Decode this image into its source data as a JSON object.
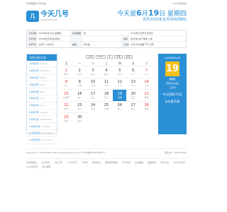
{
  "top": {
    "left": "农历网首页 天天在线",
    "right": "2023年农历表"
  },
  "logo": {
    "mark": "几",
    "title": "今天几号",
    "url": "jintianjihao.com"
  },
  "today": {
    "pre": "今天是",
    "month": "6",
    "mid": "月",
    "day": "19",
    "post": "日 星期四",
    "sub": "农历2025年五月廿四(周四)"
  },
  "info": [
    [
      "今天日期",
      "2025年6月19日 星期四",
      "生肖属相",
      "蛇",
      "",
      "2025年乙巳年五月廿四"
    ],
    [
      "今天农历",
      "2025年五月廿四(周四)",
      "",
      "",
      "宜忌",
      "宜:沐浴 出行 移徙 入宅"
    ],
    [
      "今天节日",
      "父亲节 公共节日",
      "星座",
      "双子座",
      "今天相关",
      "今天几号 星期 节气 农历"
    ]
  ],
  "sidebar": {
    "title": "月份日历大全",
    "items": [
      {
        "label": "1月份日历",
        "en": "January"
      },
      {
        "label": "2月份日历",
        "en": "February"
      },
      {
        "label": "3月份日历",
        "en": "March"
      },
      {
        "label": "4月份日历",
        "en": "April"
      },
      {
        "label": "5月份日历",
        "en": "May"
      },
      {
        "label": "6月份日历",
        "en": "June"
      },
      {
        "label": "7月份日历",
        "en": "July"
      },
      {
        "label": "8月份日历",
        "en": "August"
      },
      {
        "label": "9月份日历",
        "en": "September"
      },
      {
        "label": "10月份日历",
        "en": "October"
      },
      {
        "label": "11月份日历",
        "en": "November"
      },
      {
        "label": "12月份日历",
        "en": "December"
      }
    ]
  },
  "calendar": {
    "prev": "上月",
    "year": "2025",
    "month": "6",
    "next": "下月",
    "today_btn": "今天",
    "weekdays": [
      "日",
      "一",
      "二",
      "三",
      "四",
      "五",
      "六"
    ],
    "days": [
      {
        "n": "1",
        "l": "初六"
      },
      {
        "n": "2",
        "l": "初七"
      },
      {
        "n": "3",
        "l": "初八"
      },
      {
        "n": "4",
        "l": "初九"
      },
      {
        "n": "5",
        "l": "初十"
      },
      {
        "n": "6",
        "l": "十一"
      },
      {
        "n": "7",
        "l": "十二"
      },
      {
        "n": "8",
        "l": "十三"
      },
      {
        "n": "9",
        "l": "十四"
      },
      {
        "n": "10",
        "l": "十五"
      },
      {
        "n": "11",
        "l": "十六"
      },
      {
        "n": "12",
        "l": "十七"
      },
      {
        "n": "13",
        "l": "十八"
      },
      {
        "n": "14",
        "l": "十九"
      },
      {
        "n": "15",
        "l": "父亲节"
      },
      {
        "n": "16",
        "l": "廿一"
      },
      {
        "n": "17",
        "l": "廿二"
      },
      {
        "n": "18",
        "l": "廿三"
      },
      {
        "n": "19",
        "l": "廿四"
      },
      {
        "n": "20",
        "l": "廿五"
      },
      {
        "n": "21",
        "l": "夏至"
      },
      {
        "n": "22",
        "l": "廿七"
      },
      {
        "n": "23",
        "l": "廿八"
      },
      {
        "n": "24",
        "l": "廿九"
      },
      {
        "n": "25",
        "l": "六月"
      },
      {
        "n": "26",
        "l": "初二"
      },
      {
        "n": "27",
        "l": "初三"
      },
      {
        "n": "28",
        "l": "初四"
      },
      {
        "n": "29",
        "l": "初五"
      },
      {
        "n": "30",
        "l": "初六"
      }
    ],
    "selected": "19"
  },
  "panel": {
    "header": "2025年6月19日",
    "day": "19",
    "sub1": "星期四",
    "sub2": "农历五月廿四",
    "sub3": "乙巳年",
    "hl1": "今天是第170天",
    "hl2": "本年第25周"
  },
  "footer": {
    "left": "Copyright © 2016-2025 http://www.jintianjihao.com 沪ICP备18036290号-1",
    "right": "联系QQ：800013660"
  },
  "links": [
    "农历网首页",
    "今天农历",
    "今天几号",
    "二十四节气",
    "万年历",
    "黄道吉日",
    "阴历阳历转换",
    "天干地支",
    "生肖属相",
    "星座查询",
    "节日大全",
    "2025年日历",
    "2026年日历",
    "周公解梦"
  ]
}
